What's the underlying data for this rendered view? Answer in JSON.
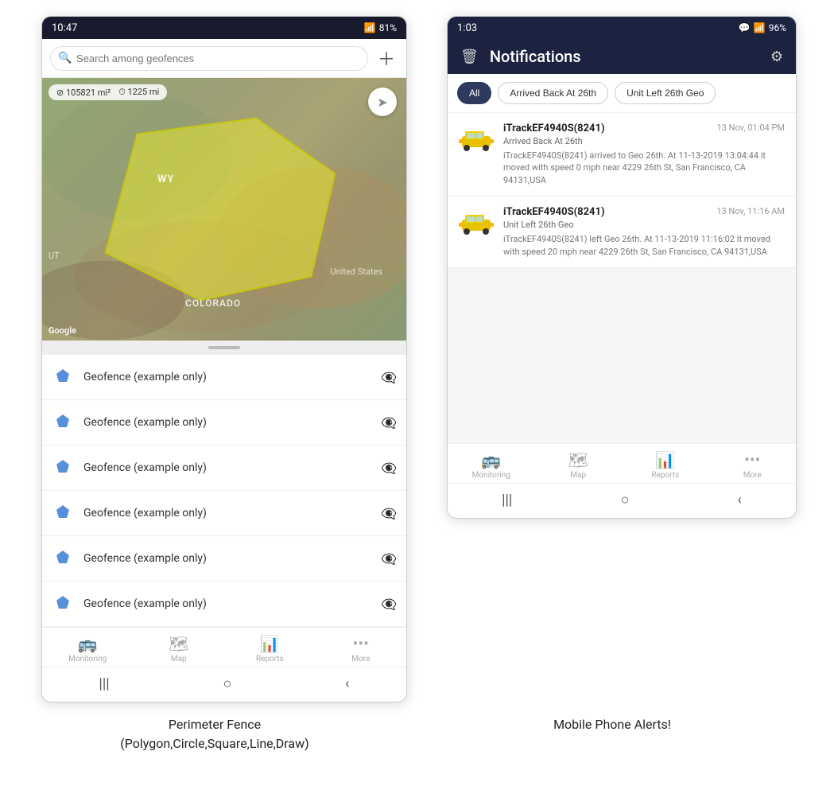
{
  "left_phone": {
    "status_bar": {
      "time": "10:47",
      "signal": "📶",
      "battery": "81%"
    },
    "search_placeholder": "Search among geofences",
    "map": {
      "stats_area": "105821 mi²",
      "stats_distance": "1225 mi",
      "label_wy": "WY",
      "label_colorado": "COLORADO",
      "label_us": "United States",
      "label_ut": "UT"
    },
    "geofence_items": [
      "Geofence (example only)",
      "Geofence (example only)",
      "Geofence (example only)",
      "Geofence (example only)",
      "Geofence (example only)",
      "Geofence (example only)"
    ],
    "bottom_nav": [
      {
        "label": "Monitoring",
        "icon": "🚌"
      },
      {
        "label": "Map",
        "icon": "🗺"
      },
      {
        "label": "Reports",
        "icon": "📊"
      },
      {
        "label": "More",
        "icon": "•••"
      }
    ]
  },
  "right_phone": {
    "status_bar": {
      "time": "1:03",
      "battery": "96%"
    },
    "header": {
      "title": "Notifications"
    },
    "filter_tabs": [
      {
        "label": "All",
        "active": true
      },
      {
        "label": "Arrived Back At 26th",
        "active": false
      },
      {
        "label": "Unit Left 26th Geo",
        "active": false
      }
    ],
    "notifications": [
      {
        "title": "iTrackEF4940S(8241)",
        "time": "13 Nov, 01:04 PM",
        "subtitle": "Arrived Back At 26th",
        "body": "iTrackEF4940S(8241) arrived to Geo 26th.    At 11-13-2019 13:04:44 it moved with speed 0 mph near 4229 26th St, San Francisco, CA 94131,USA"
      },
      {
        "title": "iTrackEF4940S(8241)",
        "time": "13 Nov, 11:16 AM",
        "subtitle": "Unit Left 26th Geo",
        "body": "iTrackEF4940S(8241) left Geo 26th.   At 11-13-2019 11:16:02 it moved with speed 20 mph near 4229 26th St, San Francisco, CA 94131,USA"
      }
    ],
    "bottom_nav": [
      {
        "label": "Monitoring",
        "icon": "🚌"
      },
      {
        "label": "Map",
        "icon": "🗺"
      },
      {
        "label": "Reports",
        "icon": "📊"
      },
      {
        "label": "More",
        "icon": "•••"
      }
    ]
  },
  "captions": {
    "left": "Perimeter Fence\n(Polygon,Circle,Square,Line,Draw)",
    "right": "Mobile Phone Alerts!"
  }
}
